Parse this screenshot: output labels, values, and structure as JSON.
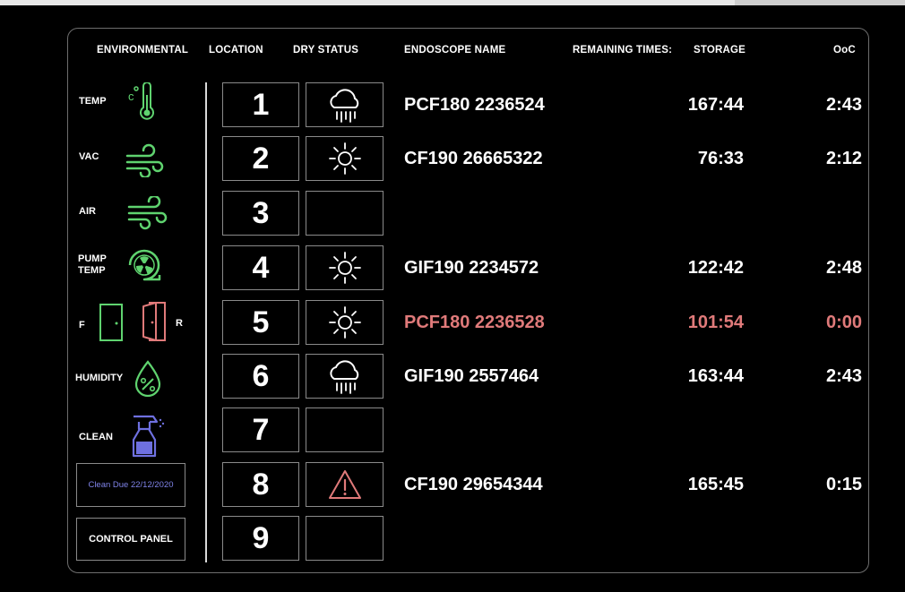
{
  "headers": {
    "environmental": "ENVIRONMENTAL",
    "location": "LOCATION",
    "dry_status": "DRY STATUS",
    "endoscope_name": "ENDOSCOPE NAME",
    "remaining_times": "REMAINING TIMES:",
    "storage": "STORAGE",
    "ooc": "OoC"
  },
  "environment": {
    "temp": "TEMP",
    "vac": "VAC",
    "air": "AIR",
    "pump_temp_line1": "PUMP",
    "pump_temp_line2": "TEMP",
    "door_front": "F",
    "door_rear": "R",
    "humidity": "HUMIDITY",
    "clean": "CLEAN",
    "clean_due": "Clean Due 22/12/2020",
    "control_panel": "CONTROL PANEL"
  },
  "colors": {
    "green": "#5fd36f",
    "red": "#e07a7a",
    "purple": "#6e70e0",
    "border": "#8a8a8a"
  },
  "slots": [
    {
      "location": "1",
      "dry_status": "cloud-rain-icon",
      "name": "PCF180 2236524",
      "storage": "167:44",
      "ooc": "2:43",
      "alert": false
    },
    {
      "location": "2",
      "dry_status": "sun-icon",
      "name": "CF190 26665322",
      "storage": "76:33",
      "ooc": "2:12",
      "alert": false
    },
    {
      "location": "3",
      "dry_status": "",
      "name": "",
      "storage": "",
      "ooc": "",
      "alert": false
    },
    {
      "location": "4",
      "dry_status": "sun-icon",
      "name": "GIF190 2234572",
      "storage": "122:42",
      "ooc": "2:48",
      "alert": false
    },
    {
      "location": "5",
      "dry_status": "sun-icon",
      "name": "PCF180 2236528",
      "storage": "101:54",
      "ooc": "0:00",
      "alert": true
    },
    {
      "location": "6",
      "dry_status": "cloud-rain-icon",
      "name": "GIF190 2557464",
      "storage": "163:44",
      "ooc": "2:43",
      "alert": false
    },
    {
      "location": "7",
      "dry_status": "",
      "name": "",
      "storage": "",
      "ooc": "",
      "alert": false
    },
    {
      "location": "8",
      "dry_status": "warning-icon",
      "name": "CF190 29654344",
      "storage": "165:45",
      "ooc": "0:15",
      "alert": false
    },
    {
      "location": "9",
      "dry_status": "",
      "name": "",
      "storage": "",
      "ooc": "",
      "alert": false
    }
  ]
}
